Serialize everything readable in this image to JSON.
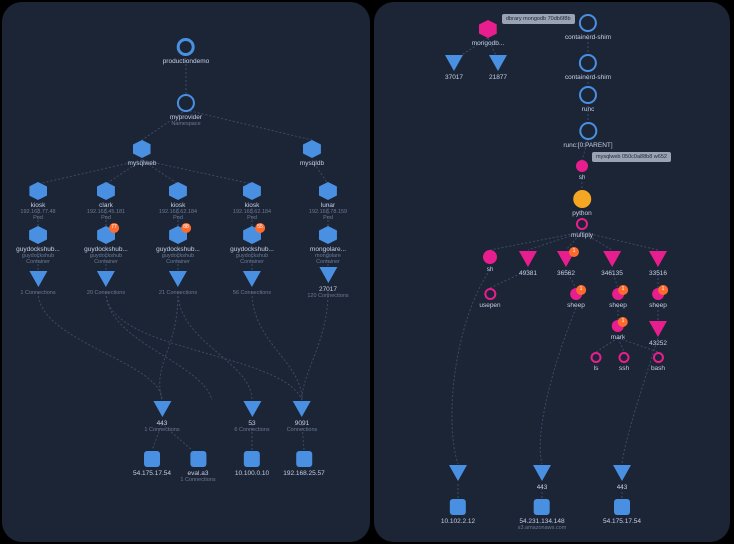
{
  "left": {
    "root": {
      "label": "productiondemo",
      "sublabel": ""
    },
    "ns": {
      "label": "myprovider",
      "sublabel": "Namespace"
    },
    "deploys": [
      {
        "label": "mysqlweb",
        "sublabel": ""
      },
      {
        "label": "mysqldb",
        "sublabel": ""
      }
    ],
    "pods": [
      {
        "label": "kiosk",
        "ip": "192.168.77.48",
        "s": "Pod"
      },
      {
        "label": "clark",
        "ip": "192.168.45.181",
        "s": "Pod"
      },
      {
        "label": "kiosk",
        "ip": "192.168.62.184",
        "s": "Pod"
      },
      {
        "label": "kiosk",
        "ip": "192.168.62.184",
        "s": "Pod"
      },
      {
        "label": "lunar",
        "ip": "192.168.78.159",
        "s": "Pod"
      }
    ],
    "containers": [
      {
        "label": "guydockshub...",
        "sub": "guydockshub",
        "s": "Container",
        "badge": ""
      },
      {
        "label": "guydockshub...",
        "sub": "guydockshub",
        "s": "Container",
        "badge": "77"
      },
      {
        "label": "guydockshub...",
        "sub": "guydockshub",
        "s": "Container",
        "badge": "88"
      },
      {
        "label": "guydockshub...",
        "sub": "guydockshub",
        "s": "Container",
        "badge": "55"
      },
      {
        "label": "mongolare...",
        "sub": "mongolare",
        "s": "Container",
        "badge": ""
      }
    ],
    "conns": [
      {
        "label": "1 Connections"
      },
      {
        "label": "20 Connections"
      },
      {
        "label": "21 Connections"
      },
      {
        "label": "56 Connections"
      },
      {
        "label": "120 Connections"
      }
    ],
    "conn5": {
      "port": "27017"
    },
    "bottomConns": [
      {
        "port": "443",
        "sub": "1 Connections"
      },
      {
        "port": "53",
        "sub": "6 Connections"
      },
      {
        "port": "9091",
        "sub": "Connections"
      }
    ],
    "ips": [
      {
        "ip": "54.175.17.54"
      },
      {
        "ip": "eval.a3",
        "sub": "1 Connections"
      },
      {
        "ip": "10.100.0.10"
      },
      {
        "ip": "192.168.25.57"
      }
    ]
  },
  "right": {
    "tooltipTop": "dbrary\nmongodb\n70db6f8b",
    "tooltipMid": "mysqlweb\n050c0a88b8\nw652",
    "rootLeft": {
      "label": "mongodb..."
    },
    "rootRight": {
      "label": "containerd-shim"
    },
    "l2": [
      {
        "label": "37017"
      },
      {
        "label": "21877"
      }
    ],
    "r2": {
      "label": "containerd-shim"
    },
    "r3": {
      "label": "runc"
    },
    "r4": {
      "label": "runc:[0:PARENT]"
    },
    "r5": {
      "label": "sh"
    },
    "r6": {
      "label": "python"
    },
    "multiply": {
      "label": "multiply"
    },
    "leaf": [
      {
        "label": "sh"
      },
      {
        "label": "49381"
      },
      {
        "label": "36562",
        "badge": "1"
      },
      {
        "label": "346135"
      },
      {
        "label": "33516"
      }
    ],
    "row2": [
      {
        "label": "usepen"
      },
      {
        "label": "sheep",
        "badge": "1"
      },
      {
        "label": "sheep",
        "badge": "1"
      },
      {
        "label": "sheep",
        "badge": "1"
      }
    ],
    "row3": [
      {
        "label": "mark",
        "badge": "1"
      },
      {
        "label": "43252"
      }
    ],
    "row4": [
      {
        "label": "ls"
      },
      {
        "label": "ssh"
      },
      {
        "label": "bash"
      }
    ],
    "bconns": [
      {
        "label": ""
      },
      {
        "port": "443"
      },
      {
        "port": "443"
      }
    ],
    "bips": [
      {
        "ip": "10.102.2.12"
      },
      {
        "ip": "54.231.134.148",
        "sub": "s3.amazonaws.com"
      },
      {
        "ip": "54.175.17.54"
      }
    ]
  }
}
